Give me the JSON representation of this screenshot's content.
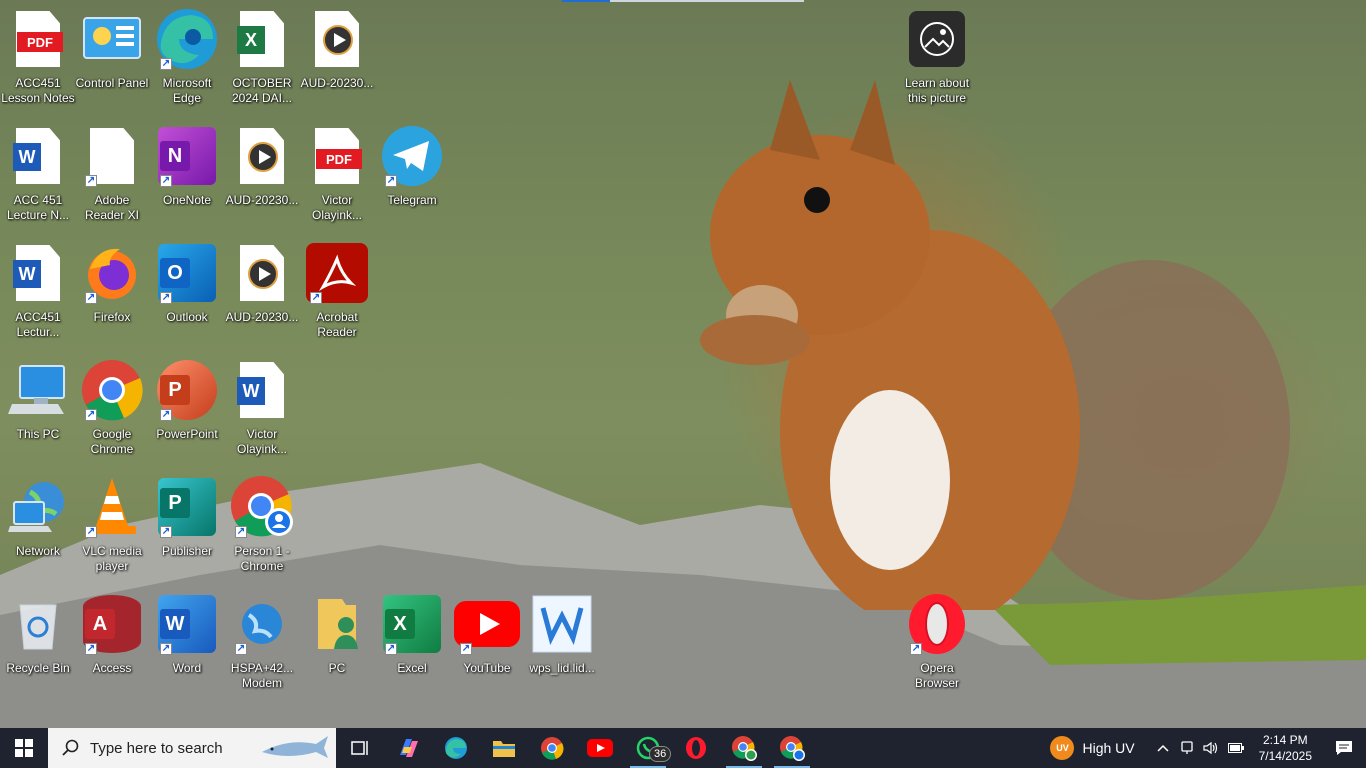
{
  "desktop": {
    "icons": {
      "acc451_lesson_notes": "ACC451 Lesson Notes",
      "control_panel": "Control Panel",
      "microsoft_edge": "Microsoft Edge",
      "october_2024": "OCTOBER 2024 DAI...",
      "aud_1": "AUD-20230...",
      "learn_picture": "Learn about this picture",
      "acc451_lecture_n": "ACC 451 Lecture N...",
      "adobe_reader_xi": "Adobe Reader XI",
      "onenote": "OneNote",
      "aud_2": "AUD-20230...",
      "victor_pdf": "Victor Olayink...",
      "telegram": "Telegram",
      "acc451_lectur": "ACC451 Lectur...",
      "firefox": "Firefox",
      "outlook": "Outlook",
      "aud_3": "AUD-20230...",
      "acrobat_reader": "Acrobat Reader",
      "this_pc": "This PC",
      "google_chrome": "Google Chrome",
      "powerpoint": "PowerPoint",
      "victor_word": "Victor Olayink...",
      "network": "Network",
      "vlc": "VLC media player",
      "publisher": "Publisher",
      "person1_chrome": "Person 1 - Chrome",
      "recycle_bin": "Recycle Bin",
      "access": "Access",
      "word": "Word",
      "hspa_modem": "HSPA+42... Modem",
      "pc": "PC",
      "excel": "Excel",
      "youtube": "YouTube",
      "wps": "wps_lid.lid...",
      "opera": "Opera Browser"
    },
    "glyphs": {
      "pdf": "PDF",
      "word_w": "W",
      "excel_x": "X",
      "onenote_n": "N",
      "outlook_o": "O",
      "ppt_p": "P",
      "pub_p": "P",
      "access_a": "A",
      "shortcut_arrow": "↗"
    }
  },
  "taskbar": {
    "search_placeholder": "Type here to search",
    "whatsapp_badge": "36",
    "weather_badge": "UV",
    "weather_text": "High UV",
    "time": "2:14 PM",
    "date": "7/14/2025",
    "colors": {
      "bar": "#1f2330",
      "active_underline": "#76b9ed"
    }
  }
}
